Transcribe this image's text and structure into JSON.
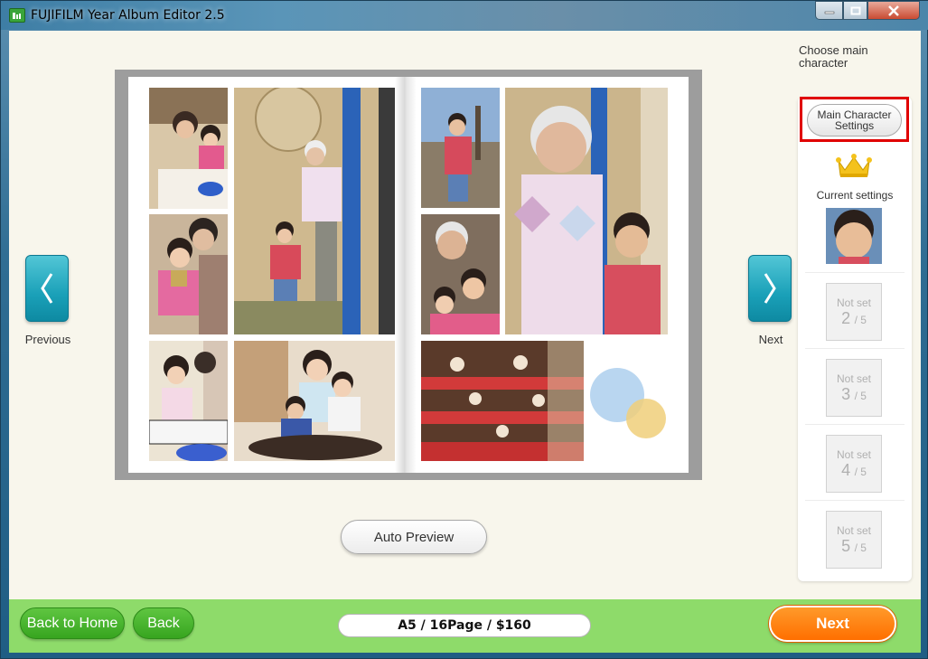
{
  "window": {
    "title": "FUJIFILM Year Album Editor 2.5"
  },
  "editor": {
    "previous_label": "Previous",
    "next_page_label": "Next",
    "auto_preview_label": "Auto Preview"
  },
  "panel": {
    "choose_label": "Choose main character",
    "main_character_button": "Main Character Settings",
    "current_settings_label": "Current settings",
    "slots": [
      {
        "label": "Not set",
        "number": "2",
        "total": "/ 5"
      },
      {
        "label": "Not set",
        "number": "3",
        "total": "/ 5"
      },
      {
        "label": "Not set",
        "number": "4",
        "total": "/ 5"
      },
      {
        "label": "Not set",
        "number": "5",
        "total": "/ 5"
      }
    ]
  },
  "footer": {
    "back_to_home": "Back to Home",
    "back": "Back",
    "summary": "A5 / 16Page / $160",
    "next": "Next"
  },
  "colors": {
    "accent_teal": "#1aa0b8",
    "footer_green": "#8edb6a",
    "button_green": "#37a51f",
    "next_orange": "#ff6f00",
    "highlight_red": "#e00000"
  }
}
